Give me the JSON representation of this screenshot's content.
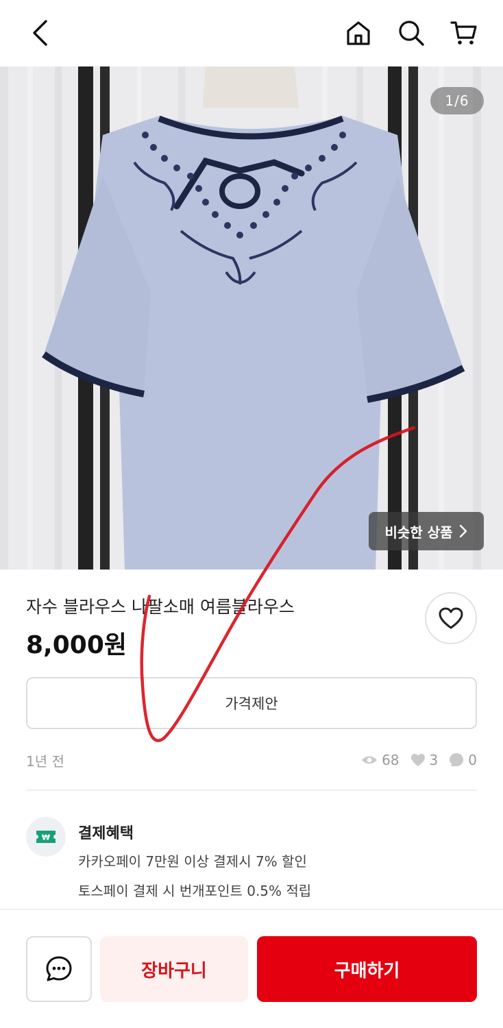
{
  "topbar": {
    "back_icon": "chevron-left-icon",
    "home_icon": "home-icon",
    "search_icon": "search-icon",
    "cart_icon": "cart-icon"
  },
  "gallery": {
    "counter": "1/6",
    "similar_label": "비슷한 상품",
    "similar_icon": "chevron-right-icon"
  },
  "product": {
    "title": "자수 블라우스 나팔소매 여름블라우스",
    "price": "8,000원"
  },
  "offer": {
    "label": "가격제안"
  },
  "meta": {
    "posted": "1년 전",
    "views": "68",
    "likes": "3",
    "chats": "0"
  },
  "benefits": {
    "title": "결제혜택",
    "line1": "카카오페이 7만원 이상 결제시 7% 할인",
    "line2": "토스페이 결제 시 번개포인트 0.5% 적립"
  },
  "actions": {
    "cart_label": "장바구니",
    "buy_label": "구매하기"
  },
  "colors": {
    "accent": "#e4000f",
    "cart_bg": "#fdf0ef",
    "cart_text": "#d6141a",
    "muted": "#999999"
  }
}
